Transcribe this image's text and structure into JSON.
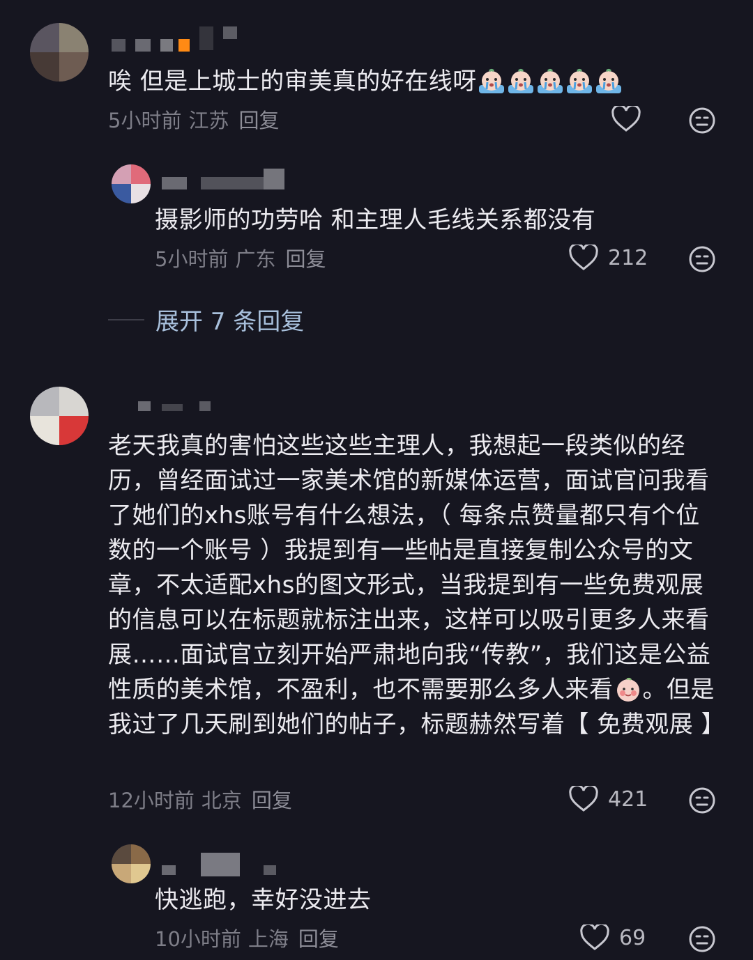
{
  "comments": [
    {
      "text": "唉 但是上城士的审美真的好在线呀",
      "emoji_count": 5,
      "time": "5小时前",
      "location": "江苏",
      "reply_label": "回复",
      "likes": ""
    },
    {
      "text": "摄影师的功劳哈 和主理人毛线关系都没有",
      "time": "5小时前",
      "location": "广东",
      "reply_label": "回复",
      "likes": "212"
    },
    {
      "text_before_emoji": "老天我真的害怕这些这些主理人，我想起一段类似的经历，曾经面试过一家美术馆的新媒体运营，面试官问我看了她们的xhs账号有什么想法，（ 每条点赞量都只有个位数的一个账号 ）我提到有一些帖是直接复制公众号的文章，不太适配xhs的图文形式，当我提到有一些免费观展的信息可以在标题就标注出来，这样可以吸引更多人来看展……面试官立刻开始严肃地向我“传教”，我们这是公益性质的美术馆，不盈利，也不需要那么多人来看",
      "text_after_emoji": "。但是我过了几天刷到她们的帖子，标题赫然写着【 免费观展 】",
      "time": "12小时前",
      "location": "北京",
      "reply_label": "回复",
      "likes": "421"
    },
    {
      "text": "快逃跑，幸好没进去",
      "time": "10小时前",
      "location": "上海",
      "reply_label": "回复",
      "likes": "69"
    }
  ],
  "expand_replies": "展开 7 条回复",
  "icons": {
    "like": "heart-outline-icon",
    "react": "meh-face-icon",
    "emoji_cry": "crying-face-emoji",
    "emoji_smile": "shy-face-emoji"
  },
  "colors": {
    "background": "#161620",
    "text": "#ecebf0",
    "meta": "#7e7e88",
    "link": "#a8c0dc"
  }
}
